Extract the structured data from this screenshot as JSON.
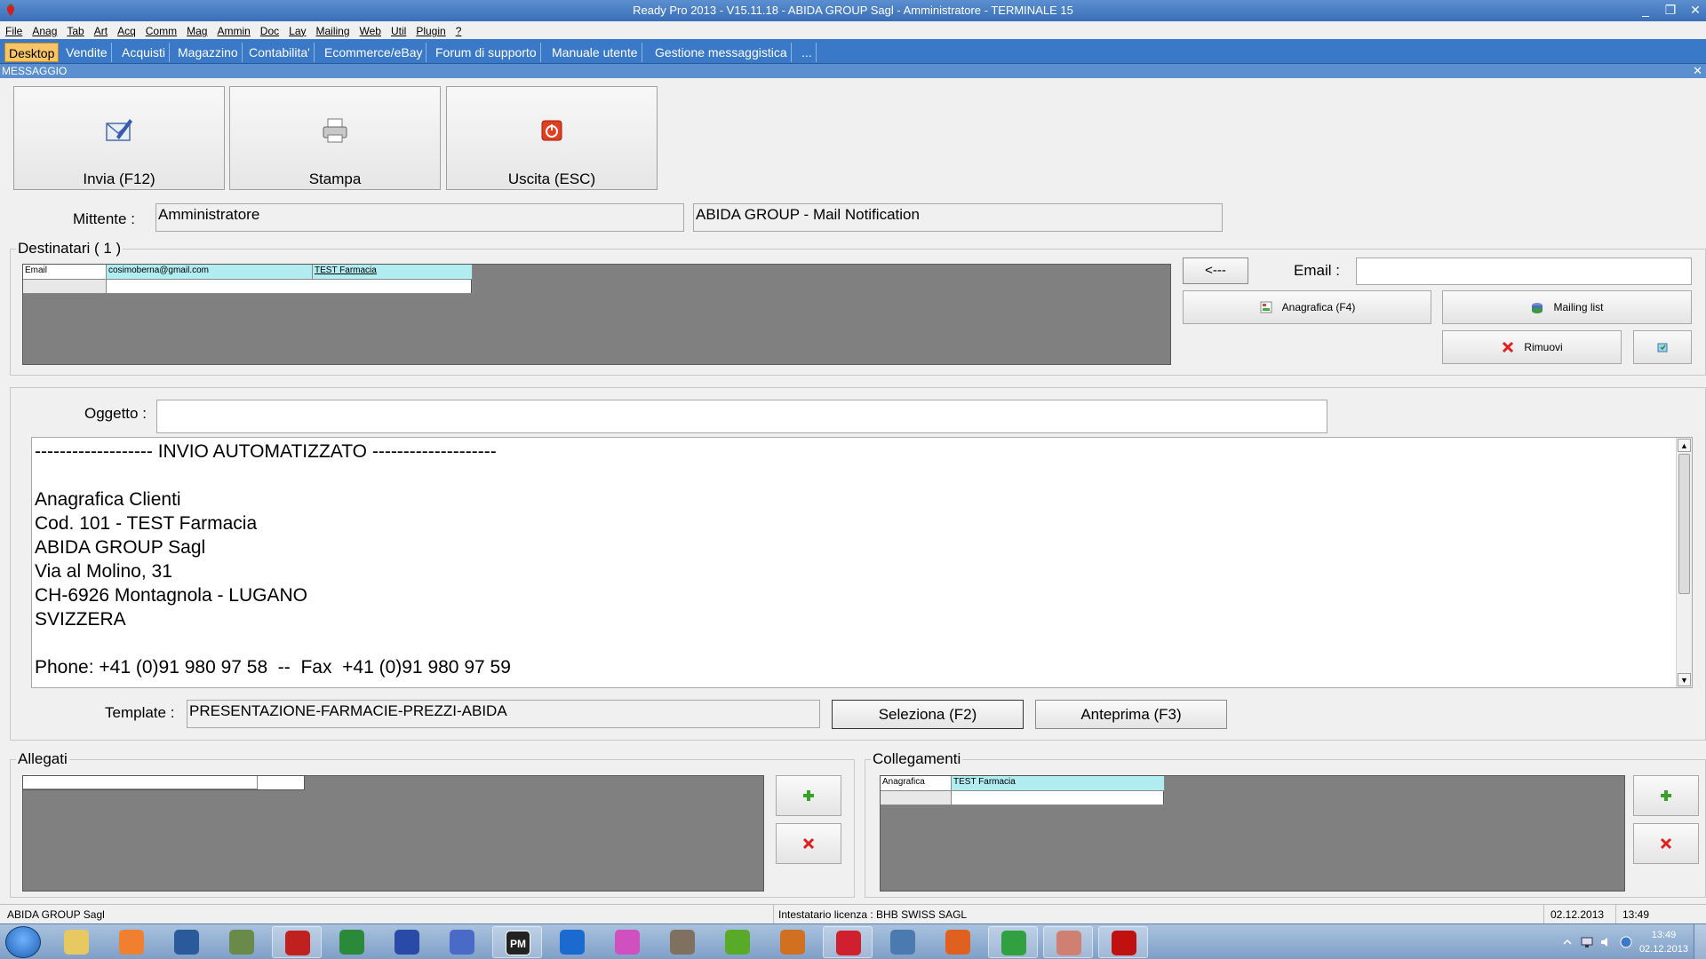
{
  "window": {
    "title": "Ready Pro 2013 - V15.11.18 - ABIDA GROUP Sagl - Amministratore - TERMINALE 15",
    "minimize": "_",
    "restore": "❐",
    "close": "✕"
  },
  "menu": [
    "File",
    "Anag",
    "Tab",
    "Art",
    "Acq",
    "Comm",
    "Mag",
    "Ammin",
    "Doc",
    "Lay",
    "Mailing",
    "Web",
    "Util",
    "Plugin",
    "?"
  ],
  "tabs": [
    "Desktop",
    "Vendite",
    "Acquisti",
    "Magazzino",
    "Contabilita'",
    "Ecommerce/eBay",
    "Forum di supporto",
    "Manuale utente",
    "Gestione messaggistica",
    "..."
  ],
  "section": {
    "title": "MESSAGGIO",
    "close": "✕"
  },
  "toolbar": {
    "send": "Invia (F12)",
    "print": "Stampa",
    "exit": "Uscita (ESC)"
  },
  "sender": {
    "label": "Mittente :",
    "name": "Amministratore",
    "account": "ABIDA GROUP - Mail Notification"
  },
  "recipients": {
    "title": "Destinatari ( 1 )",
    "columns": [
      "Email",
      "cosimoberna@gmail.com",
      "TEST Farmacia"
    ],
    "add_button": "<---",
    "email_label": "Email :",
    "email_value": "",
    "registry_button": "Anagrafica (F4)",
    "mailing_button": "Mailing list",
    "remove_button": "Rimuovi"
  },
  "subject": {
    "label": "Oggetto :",
    "value": ""
  },
  "body_lines": [
    "------------------- INVIO AUTOMATIZZATO --------------------",
    "",
    "Anagrafica Clienti",
    "Cod. 101 - TEST Farmacia",
    "ABIDA GROUP Sagl",
    "Via al Molino, 31",
    "CH-6926 Montagnola - LUGANO",
    "SVIZZERA",
    "",
    "Phone: +41 (0)91 980 97 58  --  Fax  +41 (0)91 980 97 59"
  ],
  "template": {
    "label": "Template :",
    "value": "PRESENTAZIONE-FARMACIE-PREZZI-ABIDA",
    "select_button": "Seleziona (F2)",
    "preview_button": "Anteprima (F3)"
  },
  "attachments": {
    "title": "Allegati"
  },
  "links": {
    "title": "Collegamenti",
    "col1": "Anagrafica",
    "col2": "TEST Farmacia"
  },
  "status": {
    "company": "ABIDA GROUP Sagl",
    "license": "Intestatario licenza : BHB SWISS SAGL",
    "date": "02.12.2013",
    "time": "13:49"
  },
  "taskbar": {
    "clock_time": "13:49",
    "clock_date": "02.12.2013",
    "apps": [
      "explorer-icon",
      "media-player-icon",
      "hp-icon",
      "network-icon",
      "filezilla-icon",
      "excel-icon",
      "word-icon",
      "remote-icon",
      "pm-icon",
      "teamviewer-icon",
      "picasa-icon",
      "gimp-icon",
      "utorrent-icon",
      "hamster-icon",
      "strawberry-icon",
      "remote-desktop-icon",
      "firefox-icon",
      "chrome-icon",
      "readypro-icon",
      "acrobat-icon"
    ],
    "pm_label": "PM"
  }
}
